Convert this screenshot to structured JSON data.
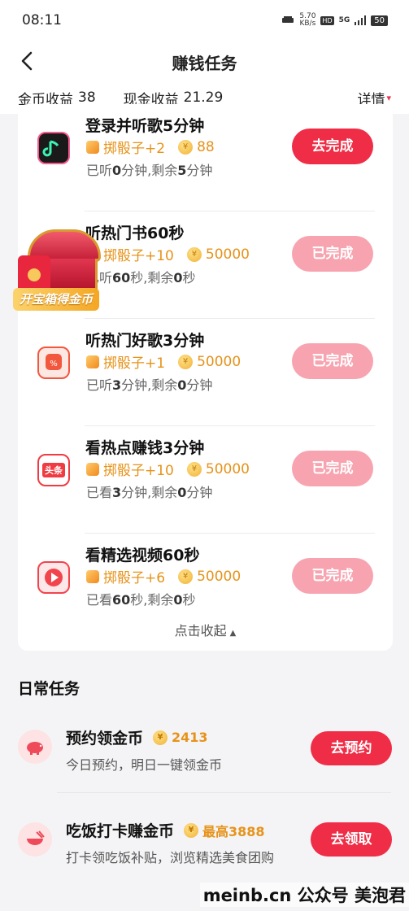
{
  "status_bar": {
    "time": "08:11",
    "speed_value": "5.70",
    "speed_unit": "KB/s",
    "hd": "HD",
    "network": "5G",
    "battery": "50"
  },
  "nav": {
    "title": "赚钱任务"
  },
  "summary": {
    "coin_label": "金币收益",
    "coin_value": "38",
    "cash_label": "现金收益",
    "cash_value": "21.29",
    "detail_label": "详情"
  },
  "tasks": [
    {
      "title": "登录并听歌5分钟",
      "dice_reward": "掷骰子+2",
      "coin_reward": "88",
      "progress_prefix": "已听",
      "progress_done": "0",
      "progress_mid": "分钟,剩余",
      "progress_left": "5",
      "progress_suffix": "分钟",
      "button": "去完成",
      "icon": "music-app-icon",
      "icon_color": "#1a1a1a"
    },
    {
      "title": "听热门书60秒",
      "dice_reward": "掷骰子+10",
      "coin_reward": "50000",
      "progress_prefix": "已听",
      "progress_done": "60",
      "progress_mid": "秒,剩余",
      "progress_left": "0",
      "progress_suffix": "秒",
      "button": "已完成",
      "icon": "book-app-icon",
      "icon_color": "#f04b5a"
    },
    {
      "title": "听热门好歌3分钟",
      "dice_reward": "掷骰子+1",
      "coin_reward": "50000",
      "progress_prefix": "已听",
      "progress_done": "3",
      "progress_mid": "分钟,剩余",
      "progress_left": "0",
      "progress_suffix": "分钟",
      "button": "已完成",
      "icon": "song-app-icon",
      "icon_color": "#f2583e"
    },
    {
      "title": "看热点赚钱3分钟",
      "dice_reward": "掷骰子+10",
      "coin_reward": "50000",
      "progress_prefix": "已看",
      "progress_done": "3",
      "progress_mid": "分钟,剩余",
      "progress_left": "0",
      "progress_suffix": "分钟",
      "button": "已完成",
      "icon": "toutiao-app-icon",
      "icon_color": "#f03b43",
      "icon_text": "头条"
    },
    {
      "title": "看精选视频60秒",
      "dice_reward": "掷骰子+6",
      "coin_reward": "50000",
      "progress_prefix": "已看",
      "progress_done": "60",
      "progress_mid": "秒,剩余",
      "progress_left": "0",
      "progress_suffix": "秒",
      "button": "已完成",
      "icon": "video-app-icon",
      "icon_color": "#f2444c"
    }
  ],
  "collapse_label": "点击收起",
  "chest": {
    "label": "开宝箱得金币"
  },
  "daily": {
    "header": "日常任务",
    "items": [
      {
        "title": "预约领金币",
        "reward": "2413",
        "subtitle": "今日预约，明日一键领金币",
        "button": "去预约",
        "icon": "piggy-bank-icon"
      },
      {
        "title": "吃饭打卡赚金币",
        "reward": "最高3888",
        "subtitle": "打卡领吃饭补贴，浏览精选美食团购",
        "button": "去领取",
        "icon": "rice-bowl-icon"
      }
    ]
  },
  "watermark": "meinb.cn 公众号 美泡君",
  "colors": {
    "accent": "#ef2d46",
    "done_button": "#f7a4b0",
    "reward": "#e6931a"
  }
}
